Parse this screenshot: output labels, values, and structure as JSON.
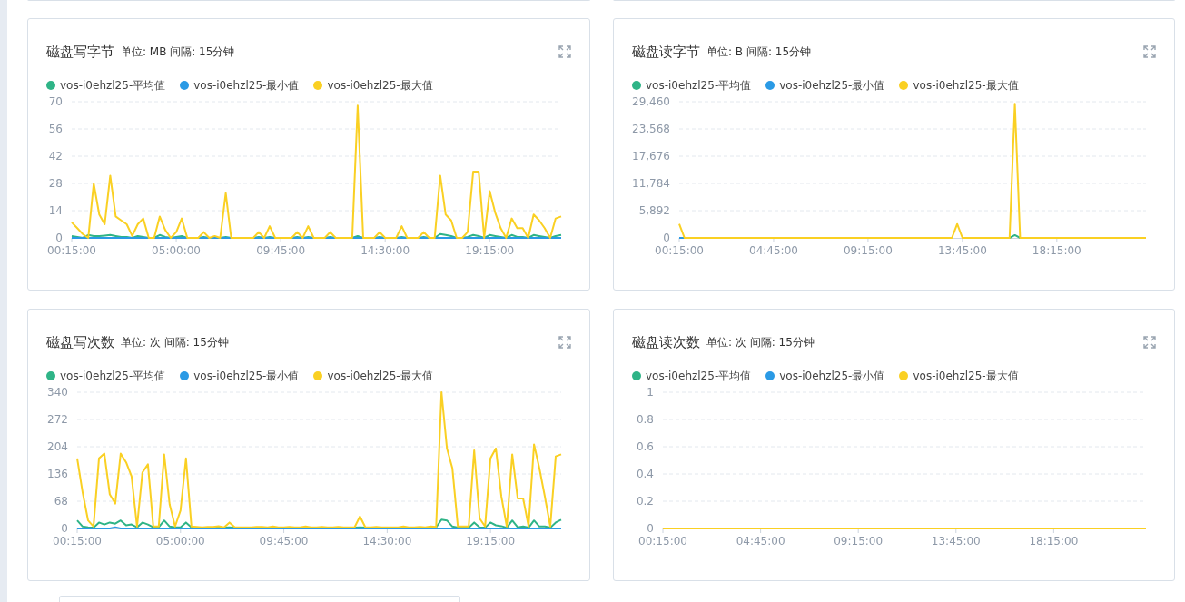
{
  "charts": [
    {
      "title": "磁盘写字节",
      "unit": "单位: MB 间隔: 15分钟",
      "chart_data": {
        "type": "line",
        "grid": true,
        "ylim": [
          0,
          70
        ],
        "yticks": [
          0,
          14,
          28,
          42,
          56,
          70
        ],
        "xlim": [
          0.25,
          22.5
        ],
        "xticks": [
          {
            "value": 0.25,
            "label": "00:15:00"
          },
          {
            "value": 5,
            "label": "05:00:00"
          },
          {
            "value": 9.75,
            "label": "09:45:00"
          },
          {
            "value": 14.5,
            "label": "14:30:00"
          },
          {
            "value": 19.25,
            "label": "19:15:00"
          }
        ],
        "x": [
          0.25,
          0.5,
          0.75,
          1,
          1.25,
          1.5,
          1.75,
          2,
          2.25,
          2.5,
          2.75,
          3,
          3.25,
          3.5,
          3.75,
          4,
          4.25,
          4.5,
          4.75,
          5,
          5.25,
          5.5,
          5.75,
          6,
          6.25,
          6.5,
          6.75,
          7,
          7.25,
          7.5,
          7.75,
          8,
          8.25,
          8.5,
          8.75,
          9,
          9.25,
          9.5,
          9.75,
          10,
          10.25,
          10.5,
          10.75,
          11,
          11.25,
          11.5,
          11.75,
          12,
          12.25,
          12.5,
          12.75,
          13,
          13.25,
          13.5,
          13.75,
          14,
          14.25,
          14.5,
          14.75,
          15,
          15.25,
          15.5,
          15.75,
          16,
          16.25,
          16.5,
          16.75,
          17,
          17.25,
          17.5,
          17.75,
          18,
          18.25,
          18.5,
          18.75,
          19,
          19.25,
          19.5,
          19.75,
          20,
          20.25,
          20.5,
          20.75,
          21,
          21.25,
          21.5,
          21.75,
          22,
          22.25,
          22.5
        ],
        "series": [
          {
            "name": "vos-i0ehzl25-平均值",
            "color": "#2fb487",
            "values": [
              1,
              0.5,
              0,
              1.5,
              1,
              1,
              1.2,
              1.5,
              1,
              0.5,
              0.5,
              0,
              1,
              0.5,
              0,
              0,
              1.5,
              0.5,
              0,
              0.5,
              1,
              0,
              0,
              0,
              0.5,
              0,
              0,
              0,
              0.5,
              0,
              0,
              0,
              0,
              0,
              0.5,
              0,
              0.5,
              0,
              0,
              0,
              0,
              0.5,
              0,
              0.5,
              0,
              0,
              0,
              0.5,
              0,
              0,
              0,
              0,
              1,
              0,
              0,
              0,
              0.5,
              0,
              0,
              0,
              0.5,
              0,
              0,
              0,
              0.5,
              0,
              0,
              2,
              1.5,
              1,
              0,
              0,
              0.5,
              1.5,
              1,
              0,
              1.5,
              1,
              0.5,
              0,
              1.5,
              0.5,
              0.5,
              0,
              1.5,
              1,
              0.5,
              0,
              1,
              1.5
            ]
          },
          {
            "name": "vos-i0ehzl25-最小值",
            "color": "#2a9ae5",
            "values": [
              0,
              0,
              0,
              0,
              0,
              0,
              0,
              0,
              0,
              0,
              0,
              0,
              0,
              0,
              0,
              0,
              0,
              0,
              0,
              0,
              0,
              0,
              0,
              0,
              0,
              0,
              0,
              0,
              0,
              0,
              0,
              0,
              0,
              0,
              0,
              0,
              0,
              0,
              0,
              0,
              0,
              0,
              0,
              0,
              0,
              0,
              0,
              0,
              0,
              0,
              0,
              0,
              0,
              0,
              0,
              0,
              0,
              0,
              0,
              0,
              0,
              0,
              0,
              0,
              0,
              0,
              0,
              0,
              0,
              0,
              0,
              0,
              0,
              0,
              0,
              0,
              0,
              0,
              0,
              0,
              0,
              0,
              0,
              0,
              0,
              0,
              0,
              0,
              0,
              0
            ]
          },
          {
            "name": "vos-i0ehzl25-最大值",
            "color": "#fad023",
            "values": [
              8,
              5,
              2,
              0,
              28,
              12,
              7,
              32,
              11,
              9,
              7,
              1,
              7,
              10,
              0,
              0,
              11,
              4,
              0,
              3,
              10,
              0,
              0,
              0,
              3,
              0,
              1,
              0,
              23,
              0,
              0,
              0,
              0,
              0,
              3,
              0,
              6,
              0,
              0,
              0,
              0,
              3,
              0,
              6,
              0,
              0,
              0,
              3,
              0,
              0,
              0,
              0,
              68,
              0,
              0,
              0,
              3,
              0,
              0,
              0,
              6,
              0,
              0,
              0,
              3,
              0,
              0,
              32,
              12,
              9,
              0,
              0,
              3,
              34,
              34,
              0,
              24,
              13,
              5,
              0,
              10,
              5,
              5,
              0,
              12,
              9,
              5,
              0,
              10,
              11
            ]
          }
        ]
      }
    },
    {
      "title": "磁盘读字节",
      "unit": "单位: B 间隔: 15分钟",
      "chart_data": {
        "type": "line",
        "grid": true,
        "ylim": [
          0,
          29460
        ],
        "yticks": [
          0,
          {
            "value": 5892,
            "label": "5,892"
          },
          {
            "value": 11784,
            "label": "11,784"
          },
          {
            "value": 17676,
            "label": "17,676"
          },
          {
            "value": 23568,
            "label": "23,568"
          },
          {
            "value": 29460,
            "label": "29,460"
          }
        ],
        "xlim": [
          0.25,
          22.5
        ],
        "xticks": [
          {
            "value": 0.25,
            "label": "00:15:00"
          },
          {
            "value": 4.75,
            "label": "04:45:00"
          },
          {
            "value": 9.25,
            "label": "09:15:00"
          },
          {
            "value": 13.75,
            "label": "13:45:00"
          },
          {
            "value": 18.25,
            "label": "18:15:00"
          }
        ],
        "x": [
          0.25,
          0.5,
          0.75,
          1,
          1.25,
          1.5,
          1.75,
          2,
          2.25,
          2.5,
          2.75,
          3,
          3.25,
          3.5,
          3.75,
          4,
          4.25,
          4.5,
          4.75,
          5,
          5.25,
          5.5,
          5.75,
          6,
          6.25,
          6.5,
          6.75,
          7,
          7.25,
          7.5,
          7.75,
          8,
          8.25,
          8.5,
          8.75,
          9,
          9.25,
          9.5,
          9.75,
          10,
          10.25,
          10.5,
          10.75,
          11,
          11.25,
          11.5,
          11.75,
          12,
          12.25,
          12.5,
          12.75,
          13,
          13.25,
          13.5,
          13.75,
          14,
          14.25,
          14.5,
          14.75,
          15,
          15.25,
          15.5,
          15.75,
          16,
          16.25,
          16.5,
          16.75,
          17,
          17.25,
          17.5,
          17.75,
          18,
          18.25,
          18.5,
          18.75,
          19,
          19.25,
          19.5,
          19.75,
          20,
          20.25,
          20.5,
          20.75,
          21,
          21.25,
          21.5,
          21.75,
          22,
          22.25,
          22.5
        ],
        "series": [
          {
            "name": "vos-i0ehzl25-平均值",
            "color": "#2fb487",
            "values": [
              null,
              null,
              null,
              null,
              null,
              null,
              null,
              null,
              null,
              null,
              null,
              null,
              null,
              null,
              null,
              null,
              null,
              null,
              null,
              null,
              null,
              null,
              null,
              null,
              null,
              null,
              null,
              null,
              null,
              null,
              null,
              null,
              null,
              null,
              null,
              null,
              null,
              null,
              null,
              null,
              null,
              null,
              null,
              null,
              null,
              null,
              null,
              null,
              null,
              null,
              null,
              null,
              null,
              null,
              null,
              null,
              null,
              null,
              null,
              null,
              null,
              null,
              null,
              0,
              600,
              0,
              null,
              null,
              null,
              null,
              null,
              null,
              null,
              null,
              null,
              null,
              null,
              null,
              null,
              null,
              null,
              null,
              null,
              null,
              null,
              null,
              null,
              null,
              null,
              null
            ]
          },
          {
            "name": "vos-i0ehzl25-最小值",
            "color": "#2a9ae5",
            "values": [
              0,
              0,
              null,
              null,
              null,
              null,
              null,
              null,
              null,
              null,
              null,
              null,
              null,
              null,
              null,
              null,
              null,
              null,
              null,
              null,
              null,
              null,
              null,
              null,
              null,
              null,
              null,
              null,
              null,
              null,
              null,
              null,
              null,
              null,
              null,
              null,
              null,
              null,
              null,
              null,
              null,
              null,
              null,
              null,
              null,
              null,
              null,
              null,
              null,
              null,
              null,
              null,
              null,
              null,
              null,
              null,
              null,
              null,
              null,
              null,
              null,
              null,
              null,
              null,
              null,
              null,
              null,
              null,
              null,
              null,
              null,
              null,
              null,
              null,
              null,
              null,
              null,
              null,
              null,
              null,
              null,
              null,
              null,
              null,
              null,
              null,
              null,
              null,
              null,
              null
            ]
          },
          {
            "name": "vos-i0ehzl25-最大值",
            "color": "#fad023",
            "values": [
              3000,
              0,
              0,
              0,
              0,
              0,
              0,
              0,
              0,
              0,
              0,
              0,
              0,
              0,
              0,
              0,
              0,
              0,
              0,
              0,
              0,
              0,
              0,
              0,
              0,
              0,
              0,
              0,
              0,
              0,
              0,
              0,
              0,
              0,
              0,
              0,
              0,
              0,
              0,
              0,
              0,
              0,
              0,
              0,
              0,
              0,
              0,
              0,
              0,
              0,
              0,
              0,
              0,
              3000,
              0,
              0,
              0,
              0,
              0,
              0,
              0,
              0,
              0,
              0,
              29000,
              0,
              0,
              0,
              0,
              0,
              0,
              0,
              0,
              0,
              0,
              0,
              0,
              0,
              0,
              0,
              0,
              0,
              0,
              0,
              0,
              0,
              0,
              0,
              0,
              0
            ]
          }
        ]
      }
    },
    {
      "title": "磁盘写次数",
      "unit": "单位: 次 间隔: 15分钟",
      "chart_data": {
        "type": "line",
        "grid": true,
        "ylim": [
          0,
          340
        ],
        "yticks": [
          0,
          68,
          136,
          204,
          272,
          340
        ],
        "xlim": [
          0.25,
          22.5
        ],
        "xticks": [
          {
            "value": 0.25,
            "label": "00:15:00"
          },
          {
            "value": 5,
            "label": "05:00:00"
          },
          {
            "value": 9.75,
            "label": "09:45:00"
          },
          {
            "value": 14.5,
            "label": "14:30:00"
          },
          {
            "value": 19.25,
            "label": "19:15:00"
          }
        ],
        "x": [
          0.25,
          0.5,
          0.75,
          1,
          1.25,
          1.5,
          1.75,
          2,
          2.25,
          2.5,
          2.75,
          3,
          3.25,
          3.5,
          3.75,
          4,
          4.25,
          4.5,
          4.75,
          5,
          5.25,
          5.5,
          5.75,
          6,
          6.25,
          6.5,
          6.75,
          7,
          7.25,
          7.5,
          7.75,
          8,
          8.25,
          8.5,
          8.75,
          9,
          9.25,
          9.5,
          9.75,
          10,
          10.25,
          10.5,
          10.75,
          11,
          11.25,
          11.5,
          11.75,
          12,
          12.25,
          12.5,
          12.75,
          13,
          13.25,
          13.5,
          13.75,
          14,
          14.25,
          14.5,
          14.75,
          15,
          15.25,
          15.5,
          15.75,
          16,
          16.25,
          16.5,
          16.75,
          17,
          17.25,
          17.5,
          17.75,
          18,
          18.25,
          18.5,
          18.75,
          19,
          19.25,
          19.5,
          19.75,
          20,
          20.25,
          20.5,
          20.75,
          21,
          21.25,
          21.5,
          21.75,
          22,
          22.25,
          22.5
        ],
        "series": [
          {
            "name": "vos-i0ehzl25-平均值",
            "color": "#2fb487",
            "values": [
              20,
              5,
              3,
              2,
              15,
              10,
              15,
              12,
              20,
              8,
              10,
              3,
              15,
              10,
              3,
              3,
              20,
              5,
              3,
              3,
              15,
              3,
              2,
              2,
              2,
              2,
              2,
              2,
              3,
              2,
              2,
              2,
              2,
              2,
              2,
              2,
              2,
              2,
              2,
              2,
              2,
              2,
              2,
              2,
              2,
              2,
              2,
              2,
              2,
              2,
              2,
              2,
              3,
              2,
              2,
              2,
              2,
              2,
              2,
              2,
              2,
              2,
              2,
              2,
              2,
              2,
              3,
              22,
              20,
              5,
              2,
              2,
              2,
              15,
              3,
              2,
              15,
              8,
              6,
              2,
              20,
              3,
              5,
              2,
              20,
              5,
              5,
              2,
              15,
              22
            ]
          },
          {
            "name": "vos-i0ehzl25-最小值",
            "color": "#2a9ae5",
            "values": [
              0,
              0,
              0,
              0,
              0,
              0,
              0,
              3,
              0,
              0,
              0,
              0,
              0,
              0,
              0,
              0,
              0,
              0,
              0,
              0,
              0,
              0,
              0,
              0,
              0,
              0,
              0,
              0,
              0,
              0,
              0,
              0,
              0,
              0,
              0,
              0,
              0,
              0,
              0,
              0,
              0,
              0,
              0,
              0,
              0,
              0,
              0,
              0,
              0,
              0,
              0,
              0,
              0,
              0,
              0,
              0,
              0,
              0,
              0,
              0,
              0,
              0,
              0,
              0,
              0,
              0,
              0,
              0,
              0,
              0,
              0,
              0,
              0,
              0,
              0,
              0,
              0,
              0,
              0,
              0,
              0,
              0,
              0,
              0,
              0,
              0,
              0,
              0,
              0,
              0
            ]
          },
          {
            "name": "vos-i0ehzl25-最大值",
            "color": "#fad023",
            "values": [
              175,
              90,
              20,
              5,
              175,
              187,
              85,
              62,
              187,
              165,
              130,
              5,
              140,
              160,
              5,
              5,
              185,
              60,
              5,
              45,
              175,
              5,
              4,
              3,
              4,
              4,
              6,
              3,
              15,
              3,
              3,
              3,
              3,
              4,
              4,
              3,
              5,
              3,
              3,
              4,
              3,
              3,
              5,
              3,
              3,
              4,
              3,
              3,
              4,
              3,
              3,
              3,
              30,
              3,
              3,
              4,
              3,
              3,
              3,
              3,
              5,
              3,
              3,
              4,
              3,
              5,
              4,
              340,
              200,
              150,
              5,
              5,
              5,
              195,
              25,
              5,
              175,
              200,
              80,
              5,
              185,
              75,
              75,
              5,
              210,
              150,
              80,
              5,
              180,
              185
            ]
          }
        ]
      }
    },
    {
      "title": "磁盘读次数",
      "unit": "单位: 次 间隔: 15分钟",
      "chart_data": {
        "type": "line",
        "grid": true,
        "ylim": [
          0,
          1
        ],
        "yticks": [
          0,
          0.2,
          0.4,
          0.6,
          0.8,
          1
        ],
        "xlim": [
          0.25,
          22.5
        ],
        "xticks": [
          {
            "value": 0.25,
            "label": "00:15:00"
          },
          {
            "value": 4.75,
            "label": "04:45:00"
          },
          {
            "value": 9.25,
            "label": "09:15:00"
          },
          {
            "value": 13.75,
            "label": "13:45:00"
          },
          {
            "value": 18.25,
            "label": "18:15:00"
          }
        ],
        "x": [
          0.25,
          0.5,
          0.75,
          1,
          1.25,
          1.5,
          1.75,
          2,
          2.25,
          2.5,
          2.75,
          3,
          3.25,
          3.5,
          3.75,
          4,
          4.25,
          4.5,
          4.75,
          5,
          5.25,
          5.5,
          5.75,
          6,
          6.25,
          6.5,
          6.75,
          7,
          7.25,
          7.5,
          7.75,
          8,
          8.25,
          8.5,
          8.75,
          9,
          9.25,
          9.5,
          9.75,
          10,
          10.25,
          10.5,
          10.75,
          11,
          11.25,
          11.5,
          11.75,
          12,
          12.25,
          12.5,
          12.75,
          13,
          13.25,
          13.5,
          13.75,
          14,
          14.25,
          14.5,
          14.75,
          15,
          15.25,
          15.5,
          15.75,
          16,
          16.25,
          16.5,
          16.75,
          17,
          17.25,
          17.5,
          17.75,
          18,
          18.25,
          18.5,
          18.75,
          19,
          19.25,
          19.5,
          19.75,
          20,
          20.25,
          20.5,
          20.75,
          21,
          21.25,
          21.5,
          21.75,
          22,
          22.25,
          22.5
        ],
        "series": [
          {
            "name": "vos-i0ehzl25-平均值",
            "color": "#2fb487",
            "values": [
              null,
              null,
              null,
              null,
              null,
              null,
              null,
              null,
              null,
              null,
              null,
              null,
              null,
              null,
              null,
              null,
              null,
              null,
              null,
              null,
              null,
              null,
              null,
              null,
              null,
              null,
              null,
              null,
              null,
              null,
              null,
              null,
              null,
              null,
              null,
              null,
              null,
              null,
              null,
              null,
              null,
              null,
              null,
              null,
              null,
              null,
              null,
              null,
              null,
              null,
              null,
              null,
              null,
              null,
              null,
              null,
              null,
              null,
              null,
              null,
              null,
              null,
              null,
              null,
              null,
              null,
              null,
              null,
              null,
              null,
              null,
              null,
              null,
              null,
              null,
              null,
              null,
              null,
              null,
              null,
              null,
              null,
              null,
              null,
              null,
              null,
              null,
              null,
              null,
              null
            ]
          },
          {
            "name": "vos-i0ehzl25-最小值",
            "color": "#2a9ae5",
            "values": [
              null,
              null,
              null,
              null,
              null,
              null,
              null,
              null,
              null,
              null,
              null,
              null,
              null,
              null,
              null,
              null,
              null,
              null,
              null,
              null,
              null,
              null,
              null,
              null,
              null,
              null,
              null,
              null,
              null,
              null,
              null,
              null,
              null,
              null,
              null,
              null,
              null,
              null,
              null,
              null,
              null,
              null,
              null,
              null,
              null,
              null,
              null,
              null,
              null,
              null,
              null,
              null,
              null,
              null,
              null,
              null,
              null,
              null,
              null,
              null,
              null,
              null,
              null,
              null,
              null,
              null,
              null,
              null,
              null,
              null,
              null,
              null,
              null,
              null,
              null,
              null,
              null,
              null,
              null,
              null,
              null,
              null,
              null,
              null,
              null,
              null,
              null,
              null,
              null,
              null
            ]
          },
          {
            "name": "vos-i0ehzl25-最大值",
            "color": "#fad023",
            "values": [
              0,
              0,
              0,
              0,
              0,
              0,
              0,
              0,
              0,
              0,
              0,
              0,
              0,
              0,
              0,
              0,
              0,
              0,
              0,
              0,
              0,
              0,
              0,
              0,
              0,
              0,
              0,
              0,
              0,
              0,
              0,
              0,
              0,
              0,
              0,
              0,
              0,
              0,
              0,
              0,
              0,
              0,
              0,
              0,
              0,
              0,
              0,
              0,
              0,
              0,
              0,
              0,
              0,
              0,
              0,
              0,
              0,
              0,
              0,
              0,
              0,
              0,
              0,
              0,
              0,
              0,
              0,
              0,
              0,
              0,
              0,
              0,
              0,
              0,
              0,
              0,
              0,
              0,
              0,
              0,
              0,
              0,
              0,
              0,
              0,
              0,
              0,
              0,
              0,
              0
            ]
          }
        ]
      }
    }
  ]
}
